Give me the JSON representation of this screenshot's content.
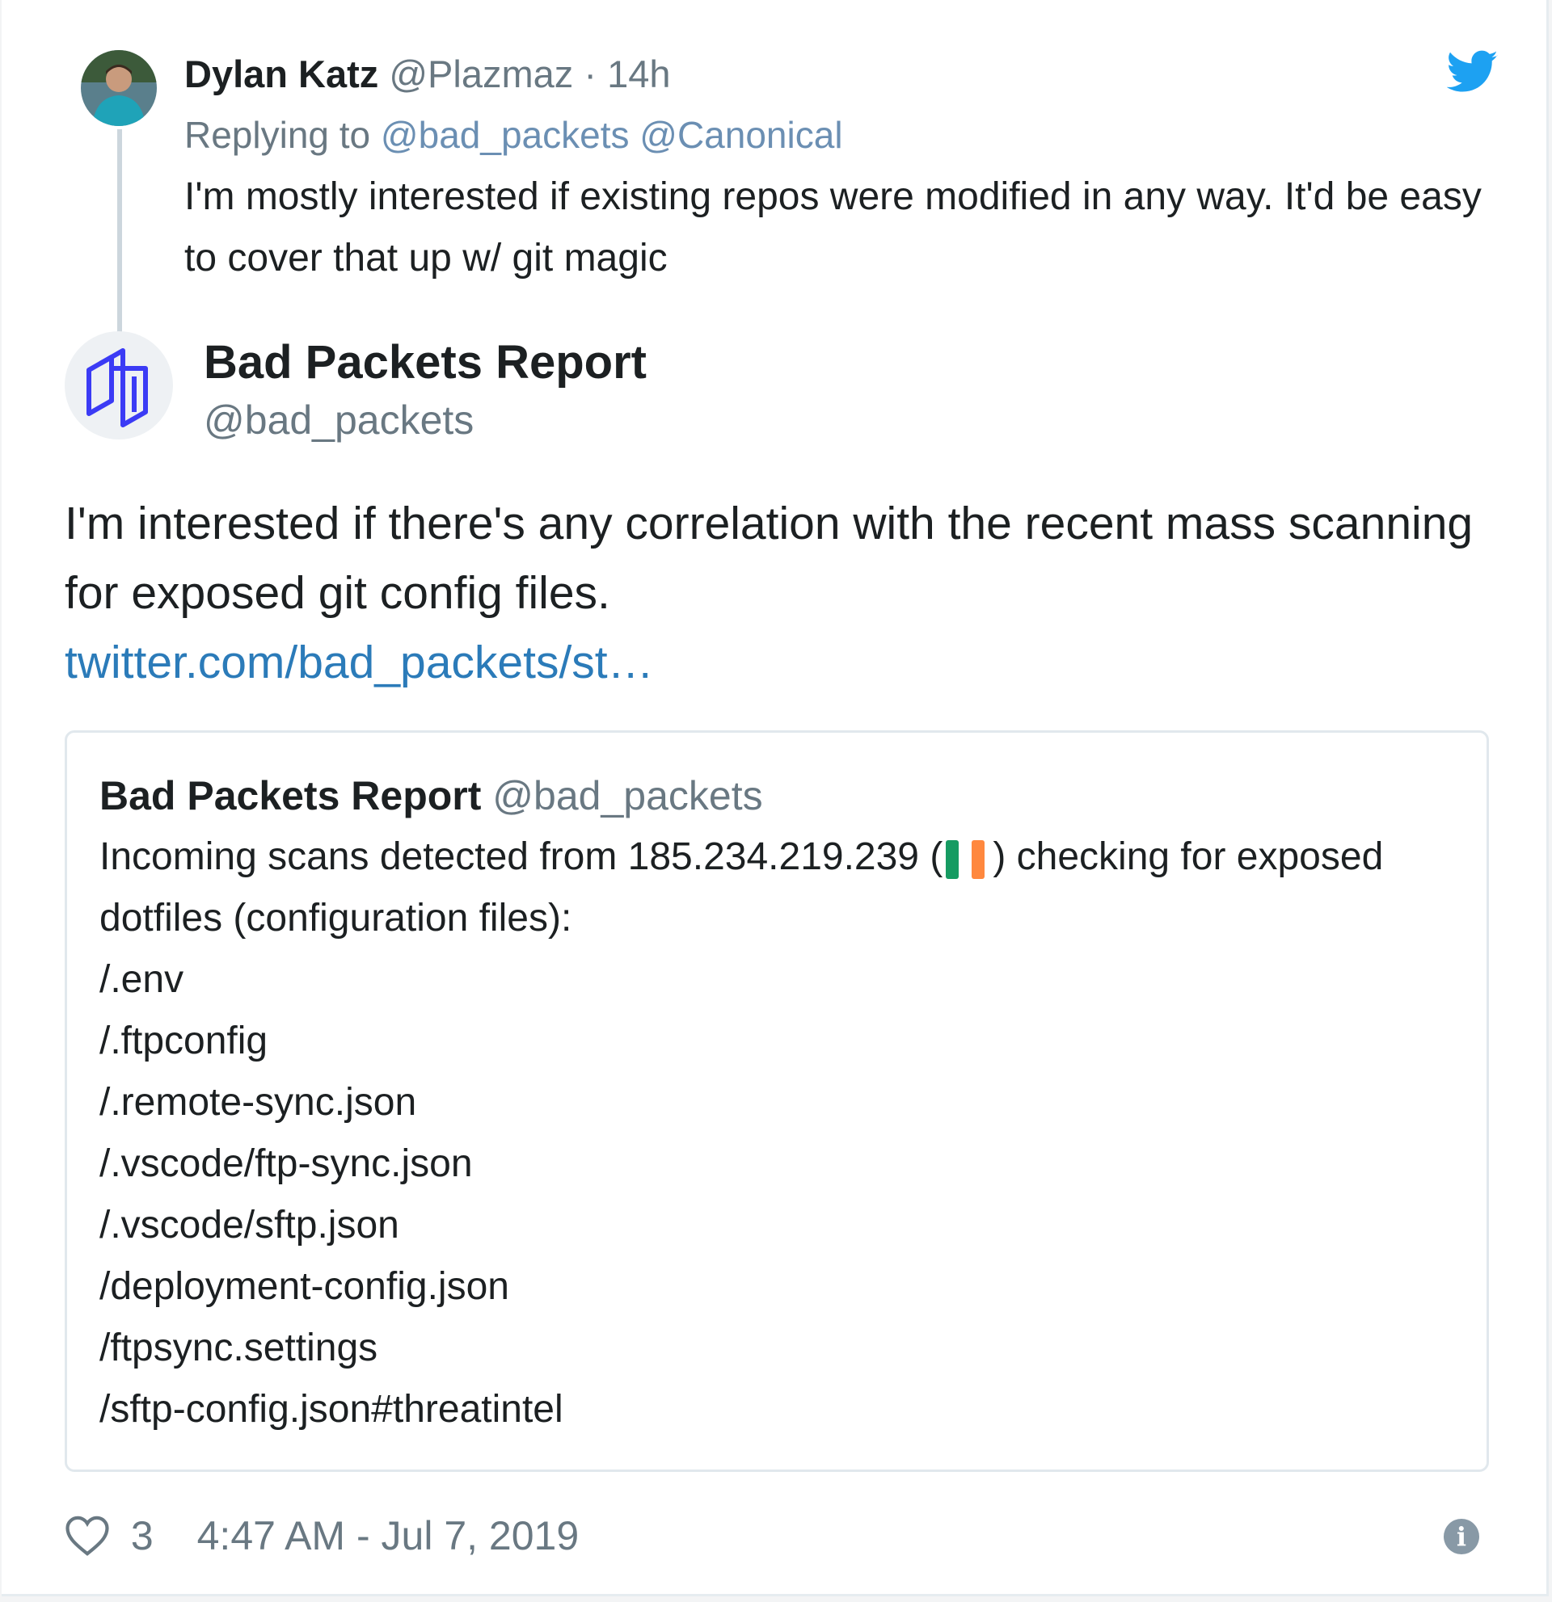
{
  "parent_tweet": {
    "author_name": "Dylan Katz",
    "author_handle": "@Plazmaz",
    "separator": "·",
    "time_ago": "14h",
    "replying_prefix": "Replying to",
    "reply_to_1": "@bad_packets",
    "reply_to_2": "@Canonical",
    "text": "I'm mostly interested if existing repos were modified in any way. It'd be easy to cover that up w/ git magic"
  },
  "main_tweet": {
    "author_name": "Bad Packets Report",
    "author_handle": "@bad_packets",
    "text": "I'm interested if there's any correlation with the recent mass scanning for exposed git config files.",
    "link": "twitter.com/bad_packets/st…"
  },
  "quoted_tweet": {
    "author_name": "Bad Packets Report",
    "author_handle": "@bad_packets",
    "text_before_flag": "Incoming scans detected from 185.234.219.239 (",
    "text_after_flag": ") checking for exposed dotfiles (configuration files):",
    "paths": [
      "/.env",
      "/.ftpconfig",
      "/.remote-sync.json",
      "/.vscode/ftp-sync.json",
      "/.vscode/sftp.json",
      "/deployment-config.json",
      "/ftpsync.settings",
      "/sftp-config.json#threatintel"
    ],
    "flag_colors": [
      "#169b62",
      "#ffffff",
      "#ff883e"
    ]
  },
  "footer": {
    "likes": "3",
    "timestamp": "4:47 AM - Jul 7, 2019",
    "info_icon": "i"
  },
  "colors": {
    "link": "#2b7bb9",
    "muted": "#697882",
    "twitter_blue": "#1da1f2",
    "logo_blue": "#3b3bf5"
  }
}
